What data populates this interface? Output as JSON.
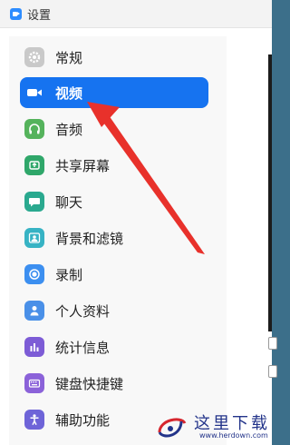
{
  "window": {
    "title": "设置"
  },
  "sidebar": {
    "items": [
      {
        "label": "常规",
        "icon": "gear-icon",
        "color": "#c9c9c9"
      },
      {
        "label": "视频",
        "icon": "video-camera-icon",
        "color": "#1673f0",
        "active": true
      },
      {
        "label": "音频",
        "icon": "headphones-icon",
        "color": "#55b35c"
      },
      {
        "label": "共享屏幕",
        "icon": "share-screen-icon",
        "color": "#2fa76a"
      },
      {
        "label": "聊天",
        "icon": "chat-bubble-icon",
        "color": "#2aa98f"
      },
      {
        "label": "背景和滤镜",
        "icon": "background-image-icon",
        "color": "#37b3c4"
      },
      {
        "label": "录制",
        "icon": "record-icon",
        "color": "#3c8ff0"
      },
      {
        "label": "个人资料",
        "icon": "person-icon",
        "color": "#4a90e8"
      },
      {
        "label": "统计信息",
        "icon": "bar-chart-icon",
        "color": "#7d5cd6"
      },
      {
        "label": "键盘快捷键",
        "icon": "keyboard-icon",
        "color": "#8b62d9"
      },
      {
        "label": "辅助功能",
        "icon": "accessibility-icon",
        "color": "#6e64d8"
      }
    ]
  },
  "colors": {
    "accent": "#1673f0",
    "annotation_arrow": "#e8312b"
  },
  "watermark": {
    "text": "这里下载",
    "url": "www.herdown.com"
  }
}
